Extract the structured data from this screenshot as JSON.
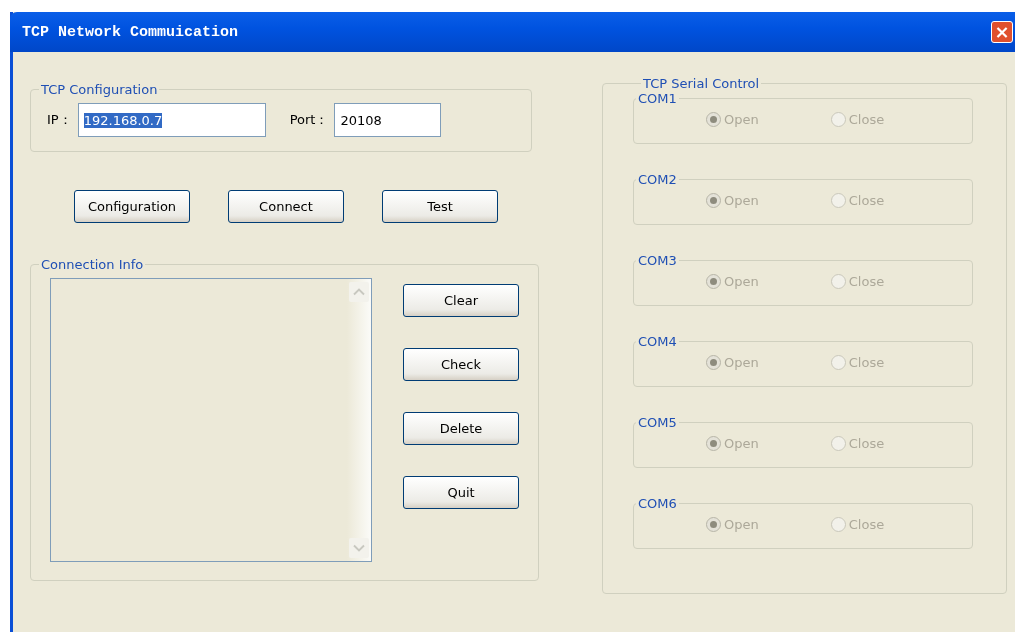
{
  "window": {
    "title": "TCP Network Commuication",
    "close": "×"
  },
  "tcp_configuration": {
    "title": "TCP Configuration",
    "fields": [
      {
        "label": "IP：",
        "value": "192.168.0.7",
        "text_selected": true
      },
      {
        "label": "Port：",
        "value": "20108",
        "text_selected": false
      }
    ]
  },
  "actions": [
    "Configuration",
    "Connect",
    "Test"
  ],
  "connection_info": {
    "title": "Connection Info",
    "buttons": [
      "Clear",
      "Check",
      "Delete",
      "Quit"
    ]
  },
  "serial_control": {
    "title": "TCP Serial Control",
    "ports": [
      {
        "name": "COM1",
        "disabled": true,
        "options": [
          {
            "label": "Open",
            "selected": true
          },
          {
            "label": "Close",
            "selected": false
          }
        ]
      },
      {
        "name": "COM2",
        "disabled": true,
        "options": [
          {
            "label": "Open",
            "selected": true
          },
          {
            "label": "Close",
            "selected": false
          }
        ]
      },
      {
        "name": "COM3",
        "disabled": true,
        "options": [
          {
            "label": "Open",
            "selected": true
          },
          {
            "label": "Close",
            "selected": false
          }
        ]
      },
      {
        "name": "COM4",
        "disabled": true,
        "options": [
          {
            "label": "Open",
            "selected": true
          },
          {
            "label": "Close",
            "selected": false
          }
        ]
      },
      {
        "name": "COM5",
        "disabled": true,
        "options": [
          {
            "label": "Open",
            "selected": true
          },
          {
            "label": "Close",
            "selected": false
          }
        ]
      },
      {
        "name": "COM6",
        "disabled": true,
        "options": [
          {
            "label": "Open",
            "selected": true
          },
          {
            "label": "Close",
            "selected": false
          }
        ]
      }
    ]
  }
}
